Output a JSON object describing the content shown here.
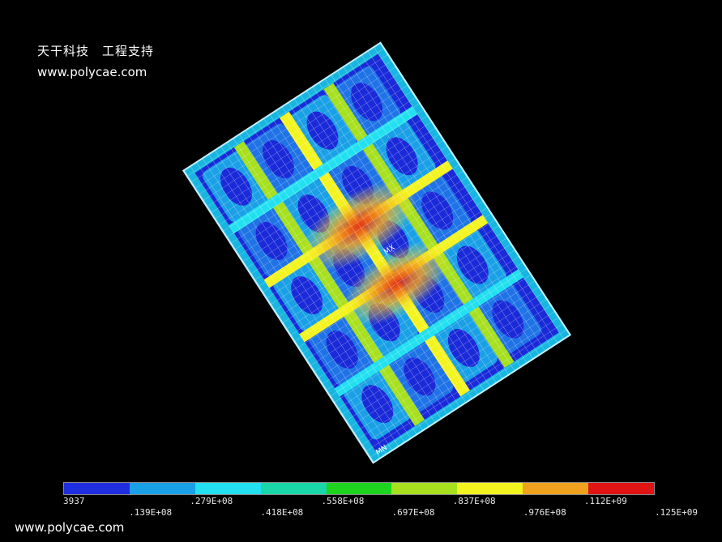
{
  "watermark": {
    "line1": "天干科技　工程支持",
    "line2": "www.polycae.com",
    "bottom": "www.polycae.com"
  },
  "model": {
    "marker_labels": [
      "MX",
      "MN"
    ]
  },
  "legend": {
    "colors": [
      "#1f2fe0",
      "#1aa0e6",
      "#22e0f0",
      "#19d7a8",
      "#1fd41f",
      "#a6e01f",
      "#f3f31f",
      "#f0a21f",
      "#e01414"
    ],
    "ticks_upper": [
      "3937",
      ".279E+08",
      ".558E+08",
      ".837E+08",
      ".112E+09"
    ],
    "ticks_lower": [
      ".139E+08",
      ".418E+08",
      ".697E+08",
      ".976E+08",
      ".125E+09"
    ]
  }
}
